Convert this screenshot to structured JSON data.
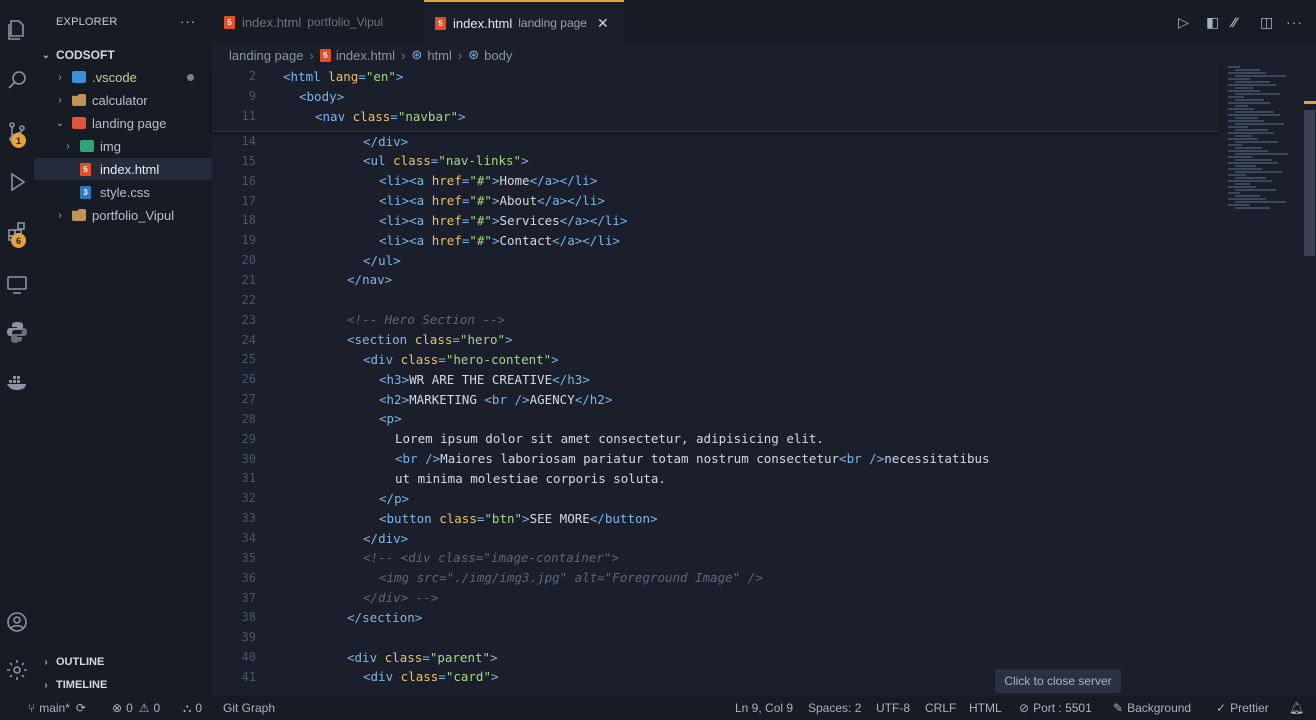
{
  "explorer": {
    "title": "EXPLORER",
    "more": "···",
    "workspace": "CODSOFT",
    "items": [
      {
        "label": ".vscode"
      },
      {
        "label": "calculator"
      },
      {
        "label": "landing page"
      },
      {
        "label": "img"
      },
      {
        "label": "index.html"
      },
      {
        "label": "style.css"
      },
      {
        "label": "portfolio_Vipul"
      }
    ],
    "outline": "OUTLINE",
    "timeline": "TIMELINE"
  },
  "activity": {
    "scm_badge": "1",
    "extensions_badge": "6"
  },
  "tabs": [
    {
      "name": "index.html",
      "desc": "portfolio_Vipul"
    },
    {
      "name": "index.html",
      "desc": "landing page",
      "close": "✕"
    }
  ],
  "breadcrumb": {
    "folder": "landing page",
    "file": "index.html",
    "sym1": "html",
    "sym2": "body"
  },
  "sticky_lines": [
    {
      "n": "2",
      "code": "<html lang=\"en\">"
    },
    {
      "n": "9",
      "code": "<body>"
    },
    {
      "n": "11",
      "code": "<nav class=\"navbar\">"
    }
  ],
  "code_lines": [
    {
      "n": "14",
      "code": "</div>"
    },
    {
      "n": "15",
      "code": "<ul class=\"nav-links\">"
    },
    {
      "n": "16",
      "code": "<li><a href=\"#\">Home</a></li>"
    },
    {
      "n": "17",
      "code": "<li><a href=\"#\">About</a></li>"
    },
    {
      "n": "18",
      "code": "<li><a href=\"#\">Services</a></li>"
    },
    {
      "n": "19",
      "code": "<li><a href=\"#\">Contact</a></li>"
    },
    {
      "n": "20",
      "code": "</ul>"
    },
    {
      "n": "21",
      "code": "</nav>"
    },
    {
      "n": "22",
      "code": ""
    },
    {
      "n": "23",
      "code": "<!-- Hero Section -->"
    },
    {
      "n": "24",
      "code": "<section class=\"hero\">"
    },
    {
      "n": "25",
      "code": "<div class=\"hero-content\">"
    },
    {
      "n": "26",
      "code": "<h3>WR ARE THE CREATIVE</h3>"
    },
    {
      "n": "27",
      "code": "<h2>MARKETING <br />AGENCY</h2>"
    },
    {
      "n": "28",
      "code": "<p>"
    },
    {
      "n": "29",
      "code": "Lorem ipsum dolor sit amet consectetur, adipisicing elit."
    },
    {
      "n": "30",
      "code": "<br />Maiores laboriosam pariatur totam nostrum consectetur<br />necessitatibus"
    },
    {
      "n": "31",
      "code": "ut minima molestiae corporis soluta."
    },
    {
      "n": "32",
      "code": "</p>"
    },
    {
      "n": "33",
      "code": "<button class=\"btn\">SEE MORE</button>"
    },
    {
      "n": "34",
      "code": "</div>"
    },
    {
      "n": "35",
      "code": "<!-- <div class=\"image-container\">"
    },
    {
      "n": "36",
      "code": "<img src=\"./img/img3.jpg\" alt=\"Foreground Image\" />"
    },
    {
      "n": "37",
      "code": "</div> -->"
    },
    {
      "n": "38",
      "code": "</section>"
    },
    {
      "n": "39",
      "code": ""
    },
    {
      "n": "40",
      "code": "<div class=\"parent\">"
    },
    {
      "n": "41",
      "code": "<div class=\"card\">"
    }
  ],
  "tooltip": "Click to close server",
  "status": {
    "branch": "main*",
    "errors": "0",
    "warnings": "0",
    "ports": "0",
    "git_graph": "Git Graph",
    "position": "Ln 9, Col 9",
    "spaces": "Spaces: 2",
    "encoding": "UTF-8",
    "eol": "CRLF",
    "language": "HTML",
    "port": "Port : 5501",
    "background": "Background",
    "prettier": "Prettier"
  }
}
